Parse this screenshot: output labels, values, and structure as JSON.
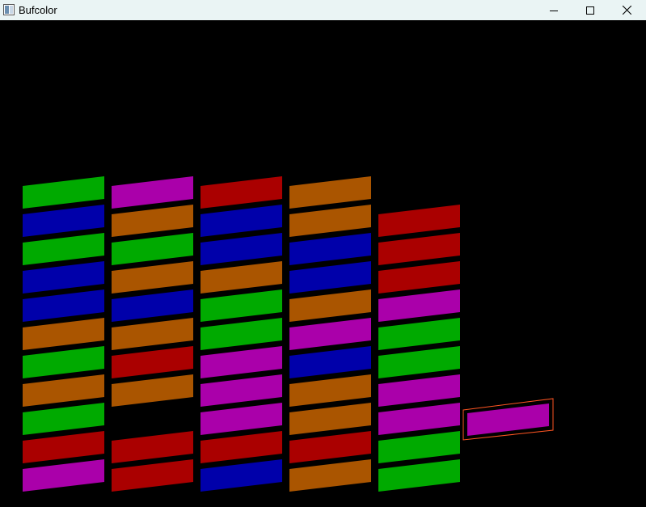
{
  "window": {
    "title": "Bufcolor"
  },
  "controls": {
    "minimize": "minimize-icon",
    "maximize": "maximize-icon",
    "close": "close-icon"
  },
  "palette": {
    "G": "#00aa00",
    "B": "#0000aa",
    "O": "#aa5500",
    "M": "#aa00aa",
    "R": "#aa0000"
  },
  "piece_outline": "#ff5522",
  "columns": [
    [
      "M",
      "R",
      "G",
      "O",
      "G",
      "O",
      "B",
      "B",
      "G",
      "B",
      "G"
    ],
    [
      "R",
      "R",
      "",
      "O",
      "R",
      "O",
      "B",
      "O",
      "G",
      "O",
      "M"
    ],
    [
      "B",
      "R",
      "M",
      "M",
      "M",
      "G",
      "G",
      "O",
      "B",
      "B",
      "R"
    ],
    [
      "O",
      "R",
      "O",
      "O",
      "B",
      "M",
      "O",
      "B",
      "B",
      "O",
      "O"
    ],
    [
      "G",
      "G",
      "M",
      "M",
      "G",
      "G",
      "M",
      "R",
      "R",
      "R"
    ]
  ],
  "falling_piece": {
    "color": "M"
  }
}
